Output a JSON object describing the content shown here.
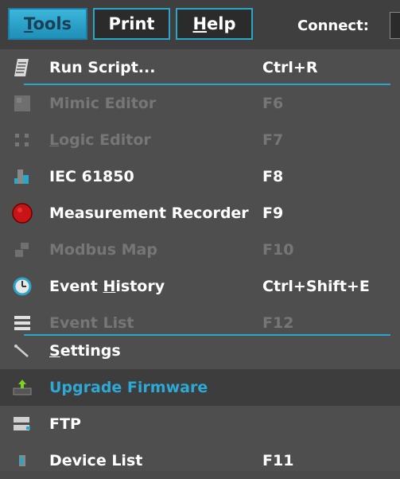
{
  "menubar": {
    "tools": "Tools",
    "print": "Print",
    "help": "Help",
    "connect_label": "Connect:"
  },
  "menu": [
    {
      "id": "run-script",
      "icon": "script-icon",
      "label": "Run Script...",
      "shortcut": "Ctrl+R",
      "disabled": false
    },
    {
      "id": "mimic-editor",
      "icon": "mimic-editor-icon",
      "label": "Mimic Editor",
      "shortcut": "F6",
      "disabled": true
    },
    {
      "id": "logic-editor",
      "icon": "logic-editor-icon",
      "label": "Logic Editor",
      "shortcut": "F7",
      "disabled": true
    },
    {
      "id": "iec-61850",
      "icon": "iec-61850-icon",
      "label": "IEC 61850",
      "shortcut": "F8",
      "disabled": false
    },
    {
      "id": "measurement-recorder",
      "icon": "record-icon",
      "label": "Measurement Recorder",
      "shortcut": "F9",
      "disabled": false
    },
    {
      "id": "modbus-map",
      "icon": "modbus-map-icon",
      "label": "Modbus Map",
      "shortcut": "F10",
      "disabled": true
    },
    {
      "id": "event-history",
      "icon": "clock-icon",
      "label": "Event History",
      "shortcut": "Ctrl+Shift+E",
      "disabled": false
    },
    {
      "id": "event-list",
      "icon": "list-icon",
      "label": "Event List",
      "shortcut": "F12",
      "disabled": true
    },
    {
      "id": "settings",
      "icon": "wrench-icon",
      "label": "Settings",
      "shortcut": "",
      "disabled": false
    },
    {
      "id": "upgrade-firmware",
      "icon": "firmware-upgrade-icon",
      "label": "Upgrade Firmware",
      "shortcut": "",
      "disabled": false,
      "highlighted": true
    },
    {
      "id": "ftp",
      "icon": "server-icon",
      "label": "FTP",
      "shortcut": "",
      "disabled": false
    },
    {
      "id": "device-list",
      "icon": "device-icon",
      "label": "Device List",
      "shortcut": "F11",
      "disabled": false
    }
  ],
  "colors": {
    "accent": "#2aa6c8",
    "menu_bg": "#4e4e4e",
    "disabled_text": "#767676",
    "highlight_text": "#2da9d6",
    "record_red": "#c81414"
  }
}
